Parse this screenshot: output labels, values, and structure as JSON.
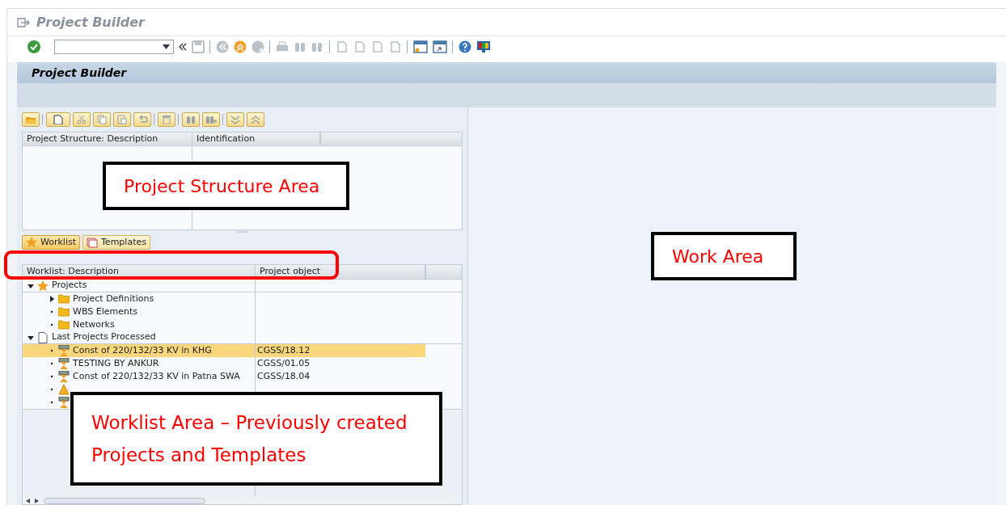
{
  "window": {
    "title": "Project Builder"
  },
  "screen_header": {
    "title": "Project Builder"
  },
  "structure_table": {
    "columns": [
      "Project Structure: Description",
      "Identification"
    ]
  },
  "worklist_tabs": [
    {
      "label": "Worklist",
      "selected": true
    },
    {
      "label": "Templates",
      "selected": false
    }
  ],
  "worklist_table": {
    "columns": [
      "Worklist: Description",
      "Project object"
    ],
    "rows": [
      {
        "label": "Projects",
        "kind": "star",
        "expanded": true,
        "children": [
          {
            "label": "Project Definitions",
            "kind": "folder",
            "expanded": false
          },
          {
            "label": "WBS Elements",
            "kind": "folder"
          },
          {
            "label": "Networks",
            "kind": "folder"
          }
        ]
      },
      {
        "label": "Last Projects Processed",
        "kind": "document",
        "expanded": true,
        "children": [
          {
            "label": "Const of 220/132/33 KV in KHG",
            "object": "CGSS/18.12",
            "kind": "project",
            "selected": true
          },
          {
            "label": "TESTING BY ANKUR",
            "object": "CGSS/01.05",
            "kind": "project",
            "selected": false
          },
          {
            "label": "Const of 220/132/33 KV in Patna SWA",
            "object": "CGSS/18.04",
            "kind": "project",
            "selected": false
          },
          {
            "kind": "wbs",
            "selected": false
          },
          {
            "kind": "project",
            "selected": false
          }
        ]
      }
    ]
  },
  "annotations": [
    {
      "kind": "box",
      "text": "Project Structure Area"
    },
    {
      "kind": "box",
      "text": "Work Area"
    },
    {
      "kind": "box",
      "text": "Worklist Area – Previously created Projects and Templates"
    },
    {
      "kind": "highlight"
    }
  ]
}
